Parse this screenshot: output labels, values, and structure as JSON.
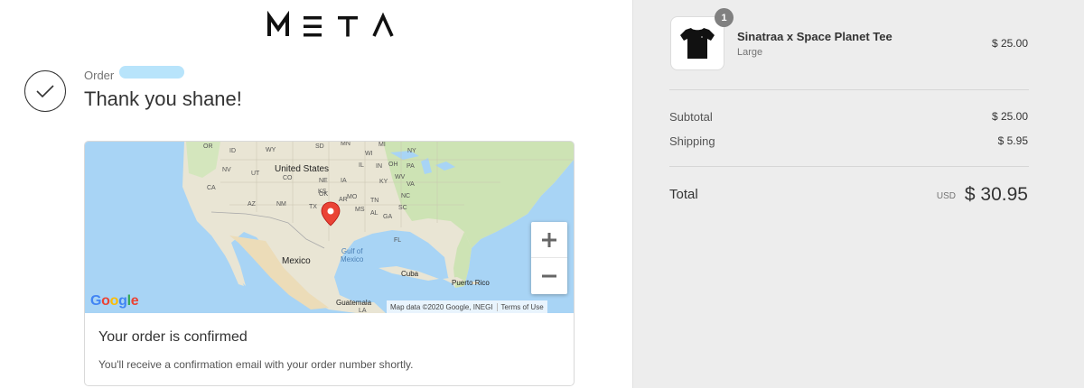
{
  "brand": {
    "logo_text": "META"
  },
  "order": {
    "order_label": "Order",
    "thank_you": "Thank you shane!"
  },
  "map": {
    "labels": {
      "us": "United States",
      "mexico": "Mexico",
      "gulf": "Gulf of\nMexico",
      "cuba": "Cuba",
      "puerto_rico": "Puerto Rico",
      "guatemala": "Guatemala",
      "la": "LA",
      "states": [
        "OR",
        "ID",
        "WY",
        "SD",
        "MN",
        "WI",
        "MI",
        "NV",
        "UT",
        "CO",
        "NE",
        "IA",
        "IL",
        "IN",
        "OH",
        "PA",
        "NY",
        "CA",
        "AZ",
        "NM",
        "KS",
        "MO",
        "KY",
        "WV",
        "VA",
        "OK",
        "TN",
        "NC",
        "AR",
        "SC",
        "TX",
        "MS",
        "AL",
        "GA",
        "LA",
        "FL"
      ]
    },
    "zoom_in": "+",
    "zoom_out": "−",
    "google": "Google",
    "attribution": "Map data ©2020 Google, INEGI",
    "terms": "Terms of Use"
  },
  "confirmation": {
    "title": "Your order is confirmed",
    "text": "You'll receive a confirmation email with your order number shortly."
  },
  "cart": {
    "item": {
      "quantity": "1",
      "name": "Sinatraa x Space Planet Tee",
      "variant": "Large",
      "price": "$ 25.00"
    },
    "subtotal_label": "Subtotal",
    "subtotal_value": "$ 25.00",
    "shipping_label": "Shipping",
    "shipping_value": "$ 5.95",
    "total_label": "Total",
    "total_currency": "USD",
    "total_value": "$ 30.95"
  },
  "colors": {
    "map_water": "#a8d4f5",
    "map_land": "#e9e5d4",
    "map_green": "#cde3b4",
    "pin": "#ea4335",
    "sidebar_bg": "#ededed",
    "redaction": "#b8e4fb"
  }
}
